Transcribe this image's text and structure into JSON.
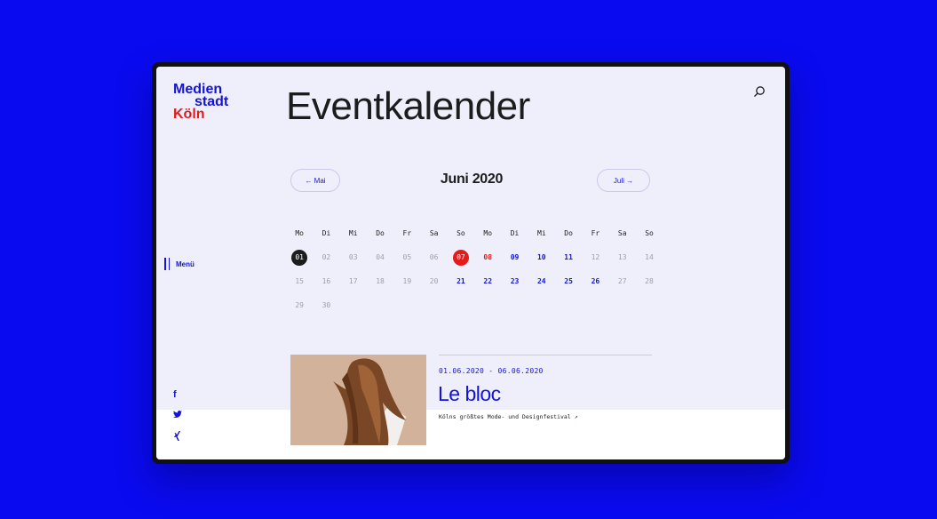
{
  "logo": {
    "line1": "Medien",
    "line2": "stadt",
    "line3": "Köln"
  },
  "page_title": "Eventkalender",
  "icons": {
    "search": "search-icon",
    "menu": "menu-bars-icon",
    "facebook": "facebook-icon",
    "twitter": "twitter-icon",
    "xing": "xing-icon",
    "external": "external-link-icon"
  },
  "menu": {
    "label": "Menü"
  },
  "calendar": {
    "prev_label": "← Mai",
    "month": "Juni 2020",
    "next_label": "Juli →",
    "weekdays": [
      "Mo",
      "Di",
      "Mi",
      "Do",
      "Fr",
      "Sa",
      "So",
      "Mo",
      "Di",
      "Mi",
      "Do",
      "Fr",
      "Sa",
      "So"
    ],
    "rows": [
      [
        {
          "d": "01",
          "s": "today"
        },
        {
          "d": "02",
          "s": "past"
        },
        {
          "d": "03",
          "s": "past"
        },
        {
          "d": "04",
          "s": "past"
        },
        {
          "d": "05",
          "s": "past"
        },
        {
          "d": "06",
          "s": "past"
        },
        {
          "d": "07",
          "s": "selected"
        },
        {
          "d": "08",
          "s": "red"
        },
        {
          "d": "09",
          "s": "event"
        },
        {
          "d": "10",
          "s": "event"
        },
        {
          "d": "11",
          "s": "event"
        },
        {
          "d": "12",
          "s": "past"
        },
        {
          "d": "13",
          "s": "past"
        },
        {
          "d": "14",
          "s": "past"
        }
      ],
      [
        {
          "d": "15",
          "s": "past"
        },
        {
          "d": "16",
          "s": "past"
        },
        {
          "d": "17",
          "s": "past"
        },
        {
          "d": "18",
          "s": "past"
        },
        {
          "d": "19",
          "s": "past"
        },
        {
          "d": "20",
          "s": "past"
        },
        {
          "d": "21",
          "s": "event"
        },
        {
          "d": "22",
          "s": "event"
        },
        {
          "d": "23",
          "s": "event"
        },
        {
          "d": "24",
          "s": "event"
        },
        {
          "d": "25",
          "s": "event"
        },
        {
          "d": "26",
          "s": "event"
        },
        {
          "d": "27",
          "s": "past"
        },
        {
          "d": "28",
          "s": "past"
        }
      ],
      [
        {
          "d": "29",
          "s": "past"
        },
        {
          "d": "30",
          "s": "past"
        }
      ]
    ]
  },
  "event": {
    "date_range": "01.06.2020 - 06.06.2020",
    "title": "Le bloc",
    "description": "Kölns größtes Mode- und Designfestival"
  },
  "social": {
    "facebook": "f",
    "twitter": "🐦",
    "xing": "✗"
  },
  "colors": {
    "background": "#0a0af0",
    "accent": "#1414d8",
    "red": "#e31b1b",
    "panel": "#efeffb"
  }
}
